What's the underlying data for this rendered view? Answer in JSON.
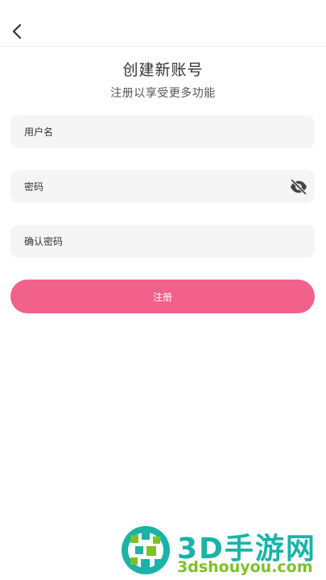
{
  "header": {
    "back_icon": "chevron-left-icon"
  },
  "title": "创建新账号",
  "subtitle": "注册以享受更多功能",
  "form": {
    "username_placeholder": "用户名",
    "password_placeholder": "密码",
    "password_toggle_icon": "eye-off-icon",
    "confirm_placeholder": "确认密码",
    "submit_label": "注册"
  },
  "colors": {
    "accent": "#f2608c",
    "field_bg": "#f5f5f5",
    "watermark_teal": "#19b3a8",
    "watermark_green": "#7fbf2b"
  },
  "watermark": {
    "brand": "3D手游网",
    "url": "3dshouyou.com"
  }
}
